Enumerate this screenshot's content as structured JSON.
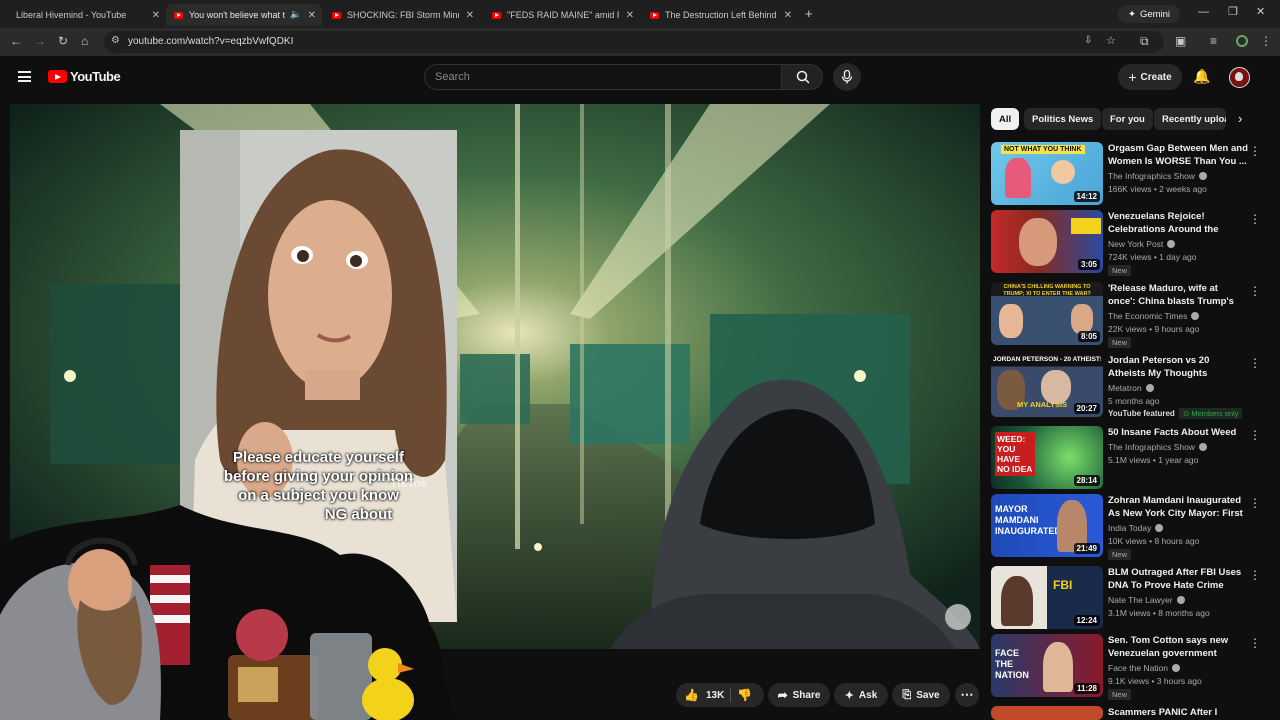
{
  "browser": {
    "tabs": [
      {
        "title": "Liberal Hivemind - YouTube",
        "active": false
      },
      {
        "title": "You won't believe what the",
        "active": true
      },
      {
        "title": "SHOCKING: FBI Storm Minneap",
        "active": false
      },
      {
        "title": "\"FEDS RAID MAINE\" amid Re",
        "active": false
      },
      {
        "title": "The Destruction Left Behind Af",
        "active": false
      }
    ],
    "new_tab": "+",
    "gemini_label": "Gemini",
    "url": "youtube.com/watch?v=eqzbVwfQDKI"
  },
  "header": {
    "logo_text": "YouTube",
    "search_placeholder": "Search",
    "create_label": "Create"
  },
  "video": {
    "caption_line1": "Please educate yourself",
    "caption_line2": "before giving your opinion",
    "caption_line3": "on a subject you know",
    "caption_line4": "NG about",
    "watermark": "TikTok"
  },
  "actions": {
    "like_count": "13K",
    "share_label": "Share",
    "ask_label": "Ask",
    "save_label": "Save"
  },
  "chips": [
    "All",
    "Politics News",
    "For you",
    "Recently uploa"
  ],
  "recommendations": [
    {
      "title": "Orgasm Gap Between Men and Women Is WORSE Than You ...",
      "channel": "The Infographics Show",
      "meta": "166K views • 2 weeks ago",
      "duration": "14:12",
      "thumb_text": "NOT WHAT YOU THINK",
      "badge": ""
    },
    {
      "title": "Venezuelans Rejoice! Celebrations Around the World...",
      "channel": "New York Post",
      "meta": "724K views • 1 day ago",
      "duration": "3:05",
      "thumb_text": "",
      "badge": "New"
    },
    {
      "title": "'Release Maduro, wife at once': China blasts Trump's 'illegal ac...",
      "channel": "The Economic Times",
      "meta": "22K views • 9 hours ago",
      "duration": "8:05",
      "thumb_text": "CHINA'S CHILLING WARNING TO TRUMP; XI TO ENTER THE WAR?",
      "badge": "New"
    },
    {
      "title": "Jordan Peterson vs 20 Atheists My Thoughts",
      "channel": "Metatron",
      "meta": "5 months ago",
      "duration": "20:27",
      "thumb_text": "JORDAN PETERSON - 20 ATHEISTS",
      "thumb_text2": "MY ANALYSIS",
      "featured": "YouTube featured",
      "members": "Members only",
      "badge": ""
    },
    {
      "title": "50 Insane Facts About Weed",
      "channel": "The Infographics Show",
      "meta": "5.1M views • 1 year ago",
      "duration": "28:14",
      "thumb_text": "WEED: YOU HAVE NO IDEA",
      "badge": ""
    },
    {
      "title": "Zohran Mamdani Inaugurated As New York City Mayor: First ...",
      "channel": "India Today",
      "meta": "10K views • 8 hours ago",
      "duration": "21:49",
      "thumb_text": "MAYOR MAMDANI INAUGURATED",
      "badge": "New"
    },
    {
      "title": "BLM Outraged After FBI Uses DNA To Prove Hate Crime Hoax",
      "channel": "Nate The Lawyer",
      "meta": "3.1M views • 8 months ago",
      "duration": "12:24",
      "thumb_text": "",
      "badge": ""
    },
    {
      "title": "Sen. Tom Cotton says new Venezuelan government cann...",
      "channel": "Face the Nation",
      "meta": "9.1K views • 3 hours ago",
      "duration": "11:28",
      "thumb_text": "FACE THE NATION",
      "badge": "New"
    },
    {
      "title": "Scammers PANIC After I",
      "channel": "",
      "meta": "",
      "duration": "",
      "thumb_text": "",
      "badge": ""
    }
  ]
}
